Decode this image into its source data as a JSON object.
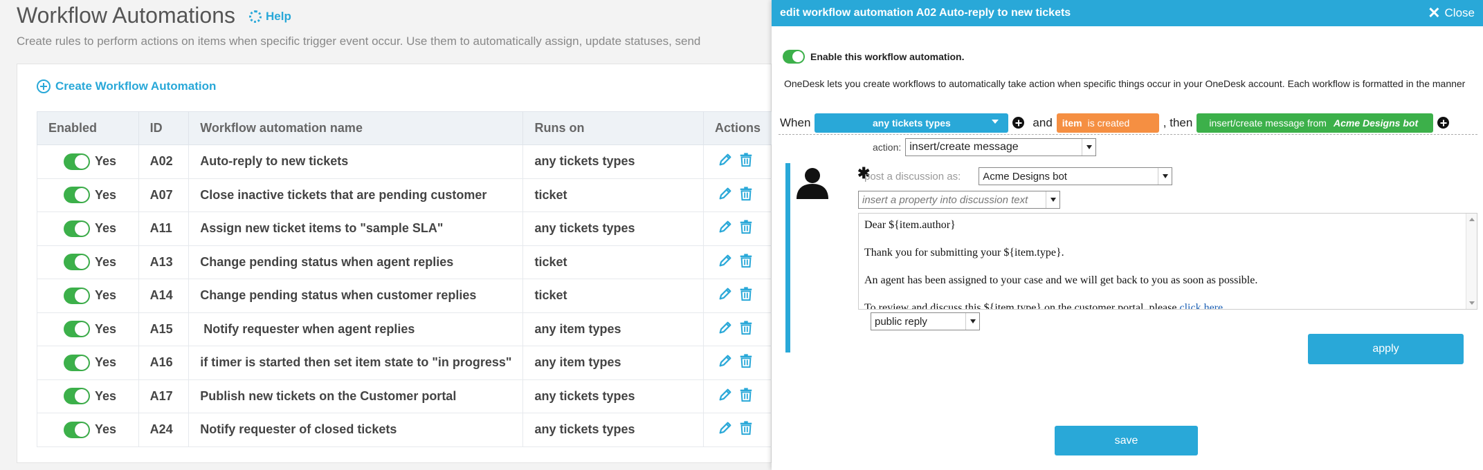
{
  "page": {
    "title": "Workflow Automations",
    "help_label": "Help",
    "description": "Create rules to perform actions on items when specific trigger event occur. Use them to automatically assign, update statuses, send"
  },
  "panel": {
    "create_label": "Create Workflow Automation",
    "columns": [
      "Enabled",
      "ID",
      "Workflow automation name",
      "Runs on",
      "Actions"
    ],
    "rows": [
      {
        "enabled": "Yes",
        "id": "A02",
        "name": "Auto-reply to new tickets",
        "runs_on": "any tickets types"
      },
      {
        "enabled": "Yes",
        "id": "A07",
        "name": "Close inactive tickets that are pending customer",
        "runs_on": "ticket"
      },
      {
        "enabled": "Yes",
        "id": "A11",
        "name": "Assign new ticket items to \"sample SLA\"",
        "runs_on": "any tickets types"
      },
      {
        "enabled": "Yes",
        "id": "A13",
        "name": "Change pending status when agent replies",
        "runs_on": "ticket"
      },
      {
        "enabled": "Yes",
        "id": "A14",
        "name": "Change pending status when customer replies",
        "runs_on": "ticket"
      },
      {
        "enabled": "Yes",
        "id": "A15",
        "name": " Notify requester when agent replies",
        "runs_on": "any item types"
      },
      {
        "enabled": "Yes",
        "id": "A16",
        "name": "if timer is started then set item state to \"in progress\"",
        "runs_on": "any item types"
      },
      {
        "enabled": "Yes",
        "id": "A17",
        "name": "Publish new tickets on the Customer portal",
        "runs_on": "any tickets types"
      },
      {
        "enabled": "Yes",
        "id": "A24",
        "name": "Notify requester of closed tickets",
        "runs_on": "any tickets types"
      }
    ]
  },
  "modal": {
    "title": "edit workflow automation A02 Auto-reply to new tickets",
    "close_label": "Close",
    "enable_label": "Enable this workflow automation.",
    "intro": "OneDesk lets you create workflows to automatically take action when specific things occur in your OneDesk account. Each workflow is formatted in the manner",
    "when_label": "When",
    "trigger_type": "any tickets types",
    "and_label": "and",
    "condition_item": "item",
    "condition_event": "is created",
    "then_label": ", then",
    "action_pill": "insert/create message from",
    "action_pill_source": "Acme Designs bot",
    "action_label": "action:",
    "action_value": "insert/create message",
    "post_as_label": "post a discussion as:",
    "post_as_value": "Acme Designs bot",
    "property_placeholder": "insert a property into discussion text",
    "message": {
      "line1": "Dear ${item.author}",
      "line2": "Thank you for submitting your ${item.type}.",
      "line3": "An agent has been assigned to your case and we will get back to you as soon as possible.",
      "line4": "To review and discuss this ${item.type} on the customer portal, please ",
      "link": "click here."
    },
    "reply_type": "public reply",
    "apply_label": "apply",
    "save_label": "save"
  },
  "colors": {
    "accent": "#29a8d8",
    "toggle_on": "#3cb04a",
    "orange": "#f58f42",
    "green": "#3cb04a"
  },
  "icons": [
    "help-icon",
    "plus-circle-icon",
    "pencil-icon",
    "trash-icon",
    "close-icon",
    "caret-down-icon",
    "user-avatar-icon"
  ]
}
